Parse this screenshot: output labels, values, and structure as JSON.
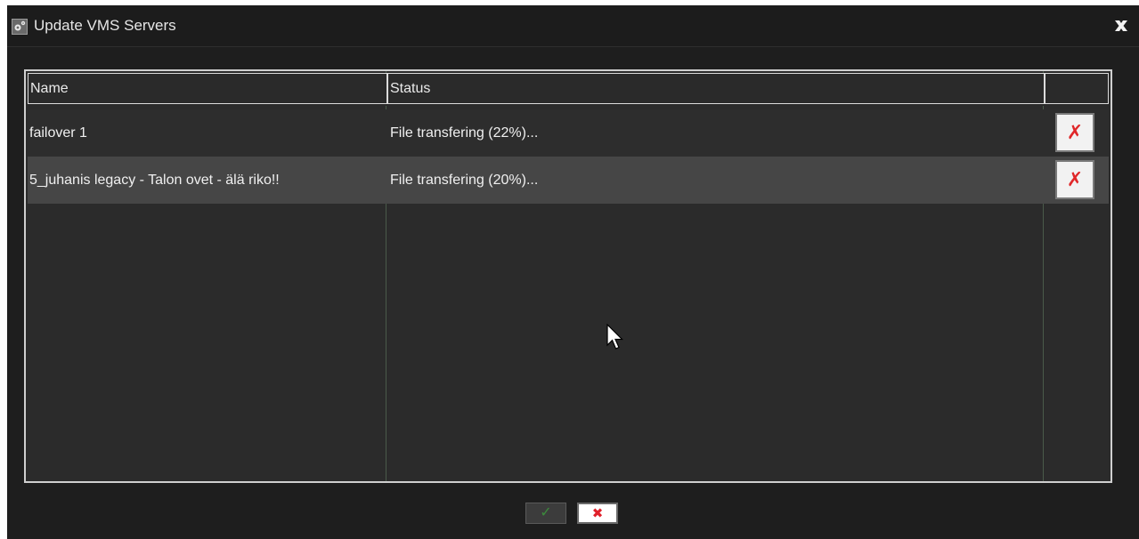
{
  "window": {
    "title": "Update VMS Servers",
    "icon": "gear-icon",
    "close_icon": "close-icon"
  },
  "table": {
    "columns": [
      "Name",
      "Status",
      ""
    ],
    "rows": [
      {
        "name": "failover 1",
        "status": "File transfering (22%)...",
        "action_icon": "delete-x-icon"
      },
      {
        "name": "5_juhanis legacy - Talon ovet - älä riko!!",
        "status": "File transfering (20%)...",
        "action_icon": "delete-x-icon"
      }
    ]
  },
  "footer": {
    "ok_icon": "checkmark-icon",
    "cancel_icon": "cancel-x-icon",
    "ok_enabled": false
  },
  "colors": {
    "background": "#1e1e1e",
    "grid_bg": "#2b2b2b",
    "row_alt": "#464646",
    "delete_red": "#e0282a",
    "ok_green": "#3c8a3c"
  }
}
